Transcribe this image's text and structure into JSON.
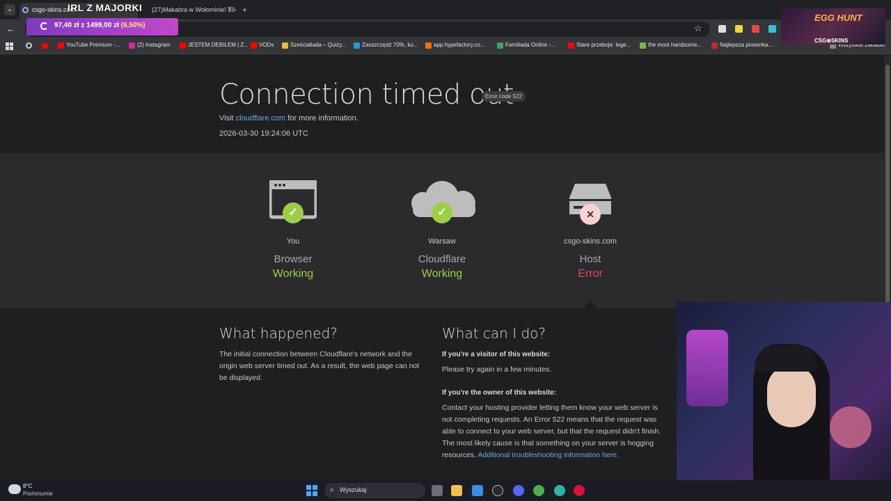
{
  "browser": {
    "tabs": [
      {
        "label": "csgo-skins.com",
        "active": true
      },
      {
        "label": "(27)Makabra w Wołominie! 19-",
        "active": false
      }
    ],
    "new_tab_symbol": "+",
    "bookmarks": [
      {
        "label": "YouTube Premium -...",
        "color": "#ff0000"
      },
      {
        "label": "(2) Instagram",
        "color": "#d6249f"
      },
      {
        "label": "JESTEM DEBILEM | Z...",
        "color": "#ff0000"
      },
      {
        "label": "VODs",
        "color": "#ff0000"
      },
      {
        "label": "Sześcialiada – Quizy...",
        "color": "#e8b84a"
      },
      {
        "label": "Zaoszczędź 70%, ku...",
        "color": "#1b9bd8"
      },
      {
        "label": "app.hypefactory.co...",
        "color": "#ff6d00"
      },
      {
        "label": "Familiada Online -...",
        "color": "#3ea36a"
      },
      {
        "label": "Stare przeboje: lege...",
        "color": "#ff0000"
      },
      {
        "label": "the most handsome...",
        "color": "#7cb342"
      },
      {
        "label": "Najlepsza piosenka...",
        "color": "#c62828"
      },
      {
        "label": "Wszystkie zakładki",
        "color": "#888888"
      }
    ]
  },
  "stream_overlay": {
    "title": "IRL Z MAJORKI",
    "donation": "97,40 zł z 1499,00 zł",
    "donation_percent": "(6,50%)",
    "egg_hunt": "EGG HUNT",
    "sponsor": "CSG⊕SKINS"
  },
  "error": {
    "title": "Connection timed out",
    "code_badge": "Error code 522",
    "visit_prefix": "Visit",
    "visit_link": "cloudflare.com",
    "visit_suffix": "for more information.",
    "timestamp": "2026-03-30 19:24:06 UTC"
  },
  "status": [
    {
      "location": "You",
      "role": "Browser",
      "state": "Working",
      "ok": true,
      "icon": "browser-icon"
    },
    {
      "location": "Warsaw",
      "role": "Cloudflare",
      "state": "Working",
      "ok": true,
      "icon": "cloud-icon"
    },
    {
      "location": "csgo-skins.com",
      "role": "Host",
      "state": "Error",
      "ok": false,
      "icon": "server-icon"
    }
  ],
  "happened": {
    "heading": "What happened?",
    "body": "The initial connection between Cloudflare's network and the origin web server timed out. As a result, the web page can not be displayed."
  },
  "cando": {
    "heading": "What can I do?",
    "visitor_heading": "If you're a visitor of this website:",
    "visitor_body": "Please try again in a few minutes.",
    "owner_heading": "If you're the owner of this website:",
    "owner_body": "Contact your hosting provider letting them know your web server is not completing requests. An Error 522 means that the request was able to connect to your web server, but that the request didn't finish. The most likely cause is that something on your server is hogging resources.",
    "owner_link": "Additional troubleshooting information here."
  },
  "taskbar": {
    "temperature": "8°C",
    "weather": "Pochmurnie",
    "search_placeholder": "Wyszukaj"
  }
}
